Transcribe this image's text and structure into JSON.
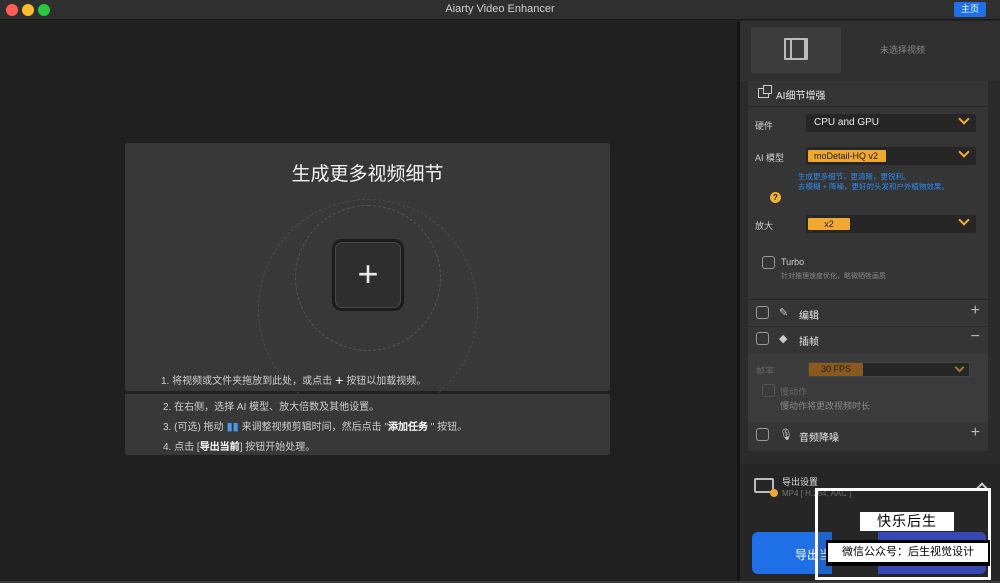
{
  "window": {
    "title": "Aiarty Video Enhancer",
    "home_button": "主页"
  },
  "main": {
    "card_title": "生成更多视频细节",
    "steps": {
      "s1_pre": "1.  将视频或文件夹拖放到此处，或点击",
      "s1_post": "按钮以加载视频。",
      "s2": "2.  在右侧，选择 AI 模型、放大倍数及其他设置。",
      "s3_pre": "3.  (可选) 拖动",
      "s3_mid": "来调整视频剪辑时间，然后点击 \"",
      "s3_bold": "添加任务",
      "s3_post": " \" 按钮。",
      "s4_pre": "4.  点击 [",
      "s4_bold": "导出当前",
      "s4_post": "] 按钮开始处理。"
    }
  },
  "sidebar": {
    "no_video": "未选择视频",
    "ai_section": "AI细节增强",
    "hardware_label": "硬件",
    "hardware_value": "CPU and GPU",
    "model_label": "AI 模型",
    "model_value": "moDetail-HQ  v2",
    "model_desc_1": "生成更多细节，更清晰，更锐利。",
    "model_desc_2": "去模糊 + 降噪，更好的头发和户外植物效果。",
    "scale_label": "放大",
    "scale_value": "x2",
    "turbo_label": "Turbo",
    "turbo_desc": "针对推理速度优化，略微牺牲画质",
    "edit_label": "编辑",
    "interp_label": "插帧",
    "fps_label": "帧率",
    "fps_value": "30 FPS",
    "slowmo_label": "慢动作",
    "slowmo_desc": "慢动作将更改视频时长",
    "denoise_label": "音频降噪",
    "export_title": "导出设置",
    "export_sub": "MP4 [ H.264, AAC ]",
    "export_btn": "导出当"
  },
  "watermark": {
    "line1": "快乐后生",
    "line2": "微信公众号：后生视觉设计"
  },
  "colors": {
    "accent_blue": "#1f6fe6",
    "accent_orange": "#f0a830"
  }
}
